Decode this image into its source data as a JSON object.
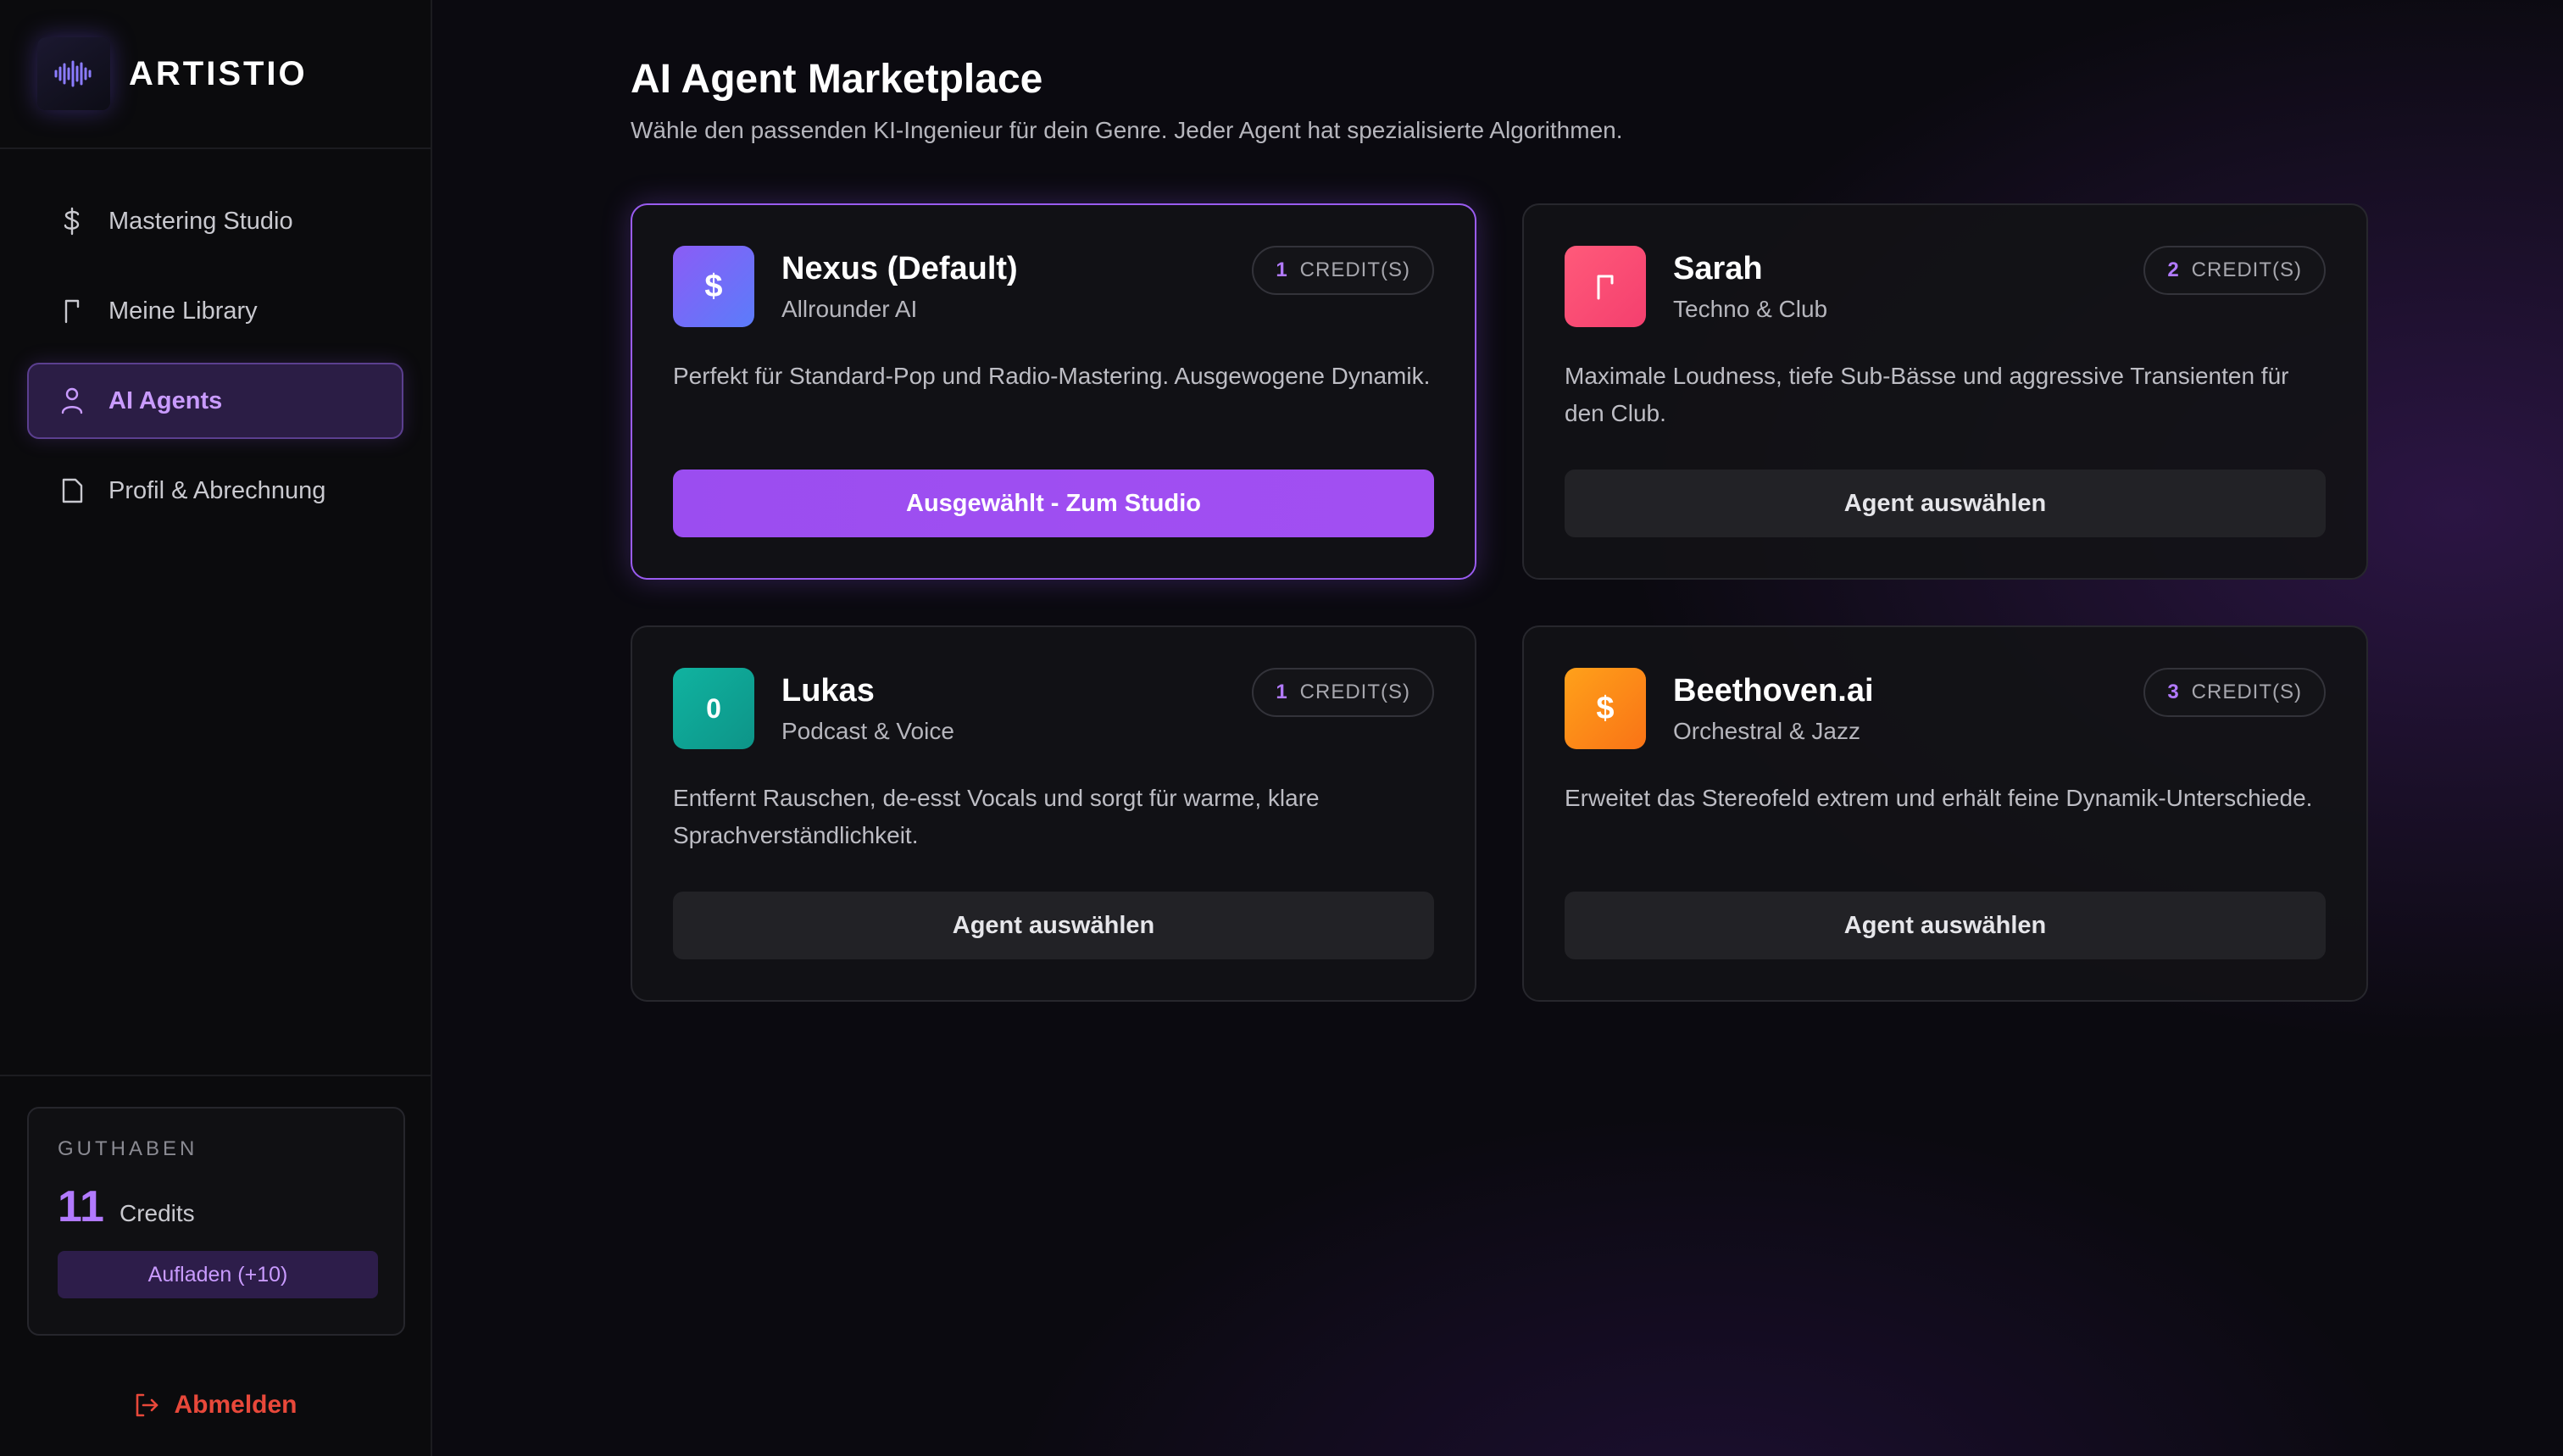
{
  "brand": {
    "name": "ARTISTIO"
  },
  "sidebar": {
    "items": [
      {
        "label": "Mastering Studio",
        "icon": "dollar-icon"
      },
      {
        "label": "Meine Library",
        "icon": "bookmark-icon"
      },
      {
        "label": "AI Agents",
        "icon": "user-icon",
        "active": true
      },
      {
        "label": "Profil & Abrechnung",
        "icon": "document-icon"
      }
    ],
    "balance": {
      "label": "GUTHABEN",
      "count": "11",
      "unit": "Credits",
      "topup_label": "Aufladen (+10)"
    },
    "logout_label": "Abmelden"
  },
  "main": {
    "title": "AI Agent Marketplace",
    "subtitle": "Wähle den passenden KI-Ingenieur für dein Genre. Jeder Agent hat spezialisierte Algorithmen.",
    "agents": [
      {
        "name": "Nexus (Default)",
        "genre": "Allrounder AI",
        "price": "1",
        "price_unit": "CREDIT(S)",
        "description": "Perfekt für Standard-Pop und Radio-Mastering. Ausgewogene Dynamik.",
        "button_label": "Ausgewählt - Zum Studio",
        "icon_glyph": "$",
        "selected": true
      },
      {
        "name": "Sarah",
        "genre": "Techno & Club",
        "price": "2",
        "price_unit": "CREDIT(S)",
        "description": "Maximale Loudness, tiefe Sub-Bässe und aggressive Transienten für den Club.",
        "button_label": "Agent auswählen",
        "icon_glyph": "⊓",
        "selected": false
      },
      {
        "name": "Lukas",
        "genre": "Podcast & Voice",
        "price": "1",
        "price_unit": "CREDIT(S)",
        "description": "Entfernt Rauschen, de-esst Vocals und sorgt für warme, klare Sprachverständlichkeit.",
        "button_label": "Agent auswählen",
        "icon_glyph": "0",
        "selected": false
      },
      {
        "name": "Beethoven.ai",
        "genre": "Orchestral & Jazz",
        "price": "3",
        "price_unit": "CREDIT(S)",
        "description": "Erweitet das Stereofeld extrem und erhält feine Dynamik-Unterschiede.",
        "button_label": "Agent auswählen",
        "icon_glyph": "$",
        "selected": false
      }
    ]
  },
  "colors": {
    "accent": "#a24ff2",
    "nexus_gradient": [
      "#8b5cf6",
      "#5b7cfa"
    ],
    "sarah_gradient": [
      "#ff5a7a",
      "#f43f6e"
    ],
    "lukas_gradient": [
      "#10b3a0",
      "#0d9488"
    ],
    "beethoven_gradient": [
      "#ffa11a",
      "#f97316"
    ],
    "logout": "#e8483a"
  }
}
